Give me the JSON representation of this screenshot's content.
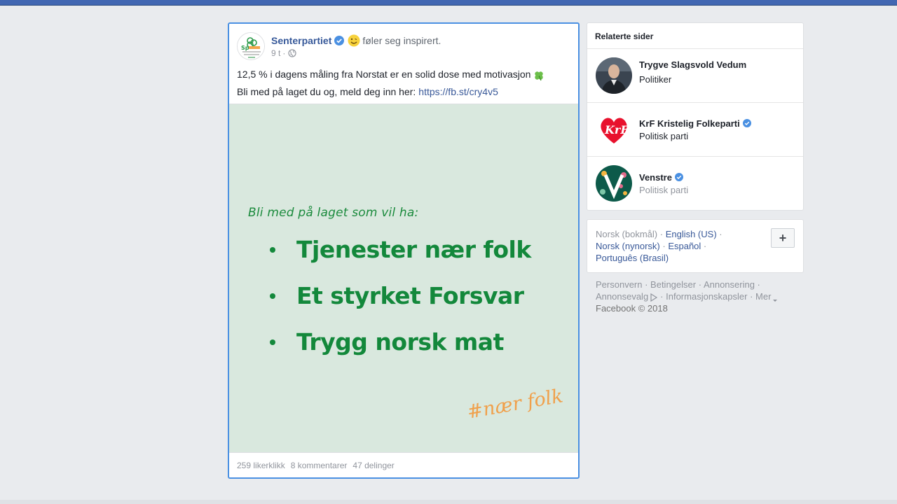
{
  "post": {
    "author": "Senterpartiet",
    "feeling": "føler seg inspirert.",
    "time": "9 t",
    "time_sep": "·",
    "text_line1": "12,5 % i dagens måling fra Norstat er en solid dose med motivasjon",
    "text_line2_prefix": "Bli med på laget du og, meld deg inn her:",
    "link": "https://fb.st/cry4v5",
    "image": {
      "heading": "Bli med på laget som vil ha:",
      "bullets": [
        "Tjenester nær folk",
        "Et styrket Forsvar",
        "Trygg norsk mat"
      ],
      "hashtag": "#nær folk",
      "bg_color": "#d9e8de",
      "text_color": "#13883b",
      "hashtag_color": "#f0a04b"
    },
    "stats": {
      "likes": "259 likerklikk",
      "comments": "8 kommentarer",
      "shares": "47 delinger"
    }
  },
  "related": {
    "title": "Relaterte sider",
    "items": [
      {
        "name": "Trygve Slagsvold Vedum",
        "sub": "Politiker",
        "verified": false
      },
      {
        "name": "KrF Kristelig Folkeparti",
        "sub": "Politisk parti",
        "verified": true
      },
      {
        "name": "Venstre",
        "sub": "Politisk parti",
        "verified": true
      }
    ]
  },
  "languages": {
    "current": "Norsk (bokmål)",
    "english": "English (US)",
    "nynorsk": "Norsk (nynorsk)",
    "espanol": "Español",
    "portugues": "Português (Brasil)",
    "plus_label": "+"
  },
  "footer": {
    "personvern": "Personvern",
    "betingelser": "Betingelser",
    "annonsering": "Annonsering",
    "annonsevalg": "Annonsevalg",
    "informasjonskapsler": "Informasjonskapsler",
    "mer": "Mer",
    "copyright": "Facebook © 2018"
  },
  "colors": {
    "topbar": "#4267b2",
    "link": "#385898",
    "selected_border": "#4a90e2"
  }
}
